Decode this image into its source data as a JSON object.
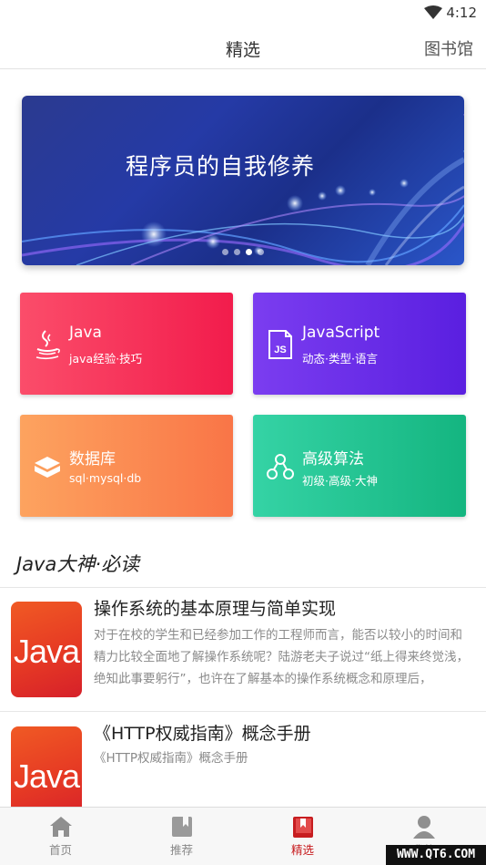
{
  "status_bar": {
    "time": "4:12",
    "wifi_icon": "wifi-icon"
  },
  "header": {
    "title": "精选",
    "library_link": "图书馆"
  },
  "banner": {
    "title": "程序员的自我修养",
    "dot_count": 4,
    "active_dot": 3
  },
  "categories": [
    {
      "name": "Java",
      "sub": "java经验·技巧",
      "icon": "java-cup-icon",
      "colors": [
        "#fb4d6a",
        "#f21c4c"
      ]
    },
    {
      "name": "JavaScript",
      "sub": "动态·类型·语言",
      "icon": "js-icon",
      "colors": [
        "#7b3df0",
        "#5a1fe0"
      ]
    },
    {
      "name": "数据库",
      "sub": "sql·mysql·db",
      "icon": "database-icon",
      "colors": [
        "#fda35f",
        "#f97547"
      ]
    },
    {
      "name": "高级算法",
      "sub": "初级·高级·大神",
      "icon": "algorithm-icon",
      "colors": [
        "#35d3a5",
        "#14b580"
      ]
    }
  ],
  "section": {
    "title": "Java大神·必读"
  },
  "books": [
    {
      "cover_text": "Java",
      "title": "操作系统的基本原理与简单实现",
      "description": "对于在校的学生和已经参加工作的工程师而言，能否以较小的时间和精力比较全面地了解操作系统呢？陆游老夫子说过“纸上得来终觉浅，绝知此事要躬行”，也许在了解基本的操作系统概念和原理后，"
    },
    {
      "cover_text": "Java",
      "title": "《HTTP权威指南》概念手册",
      "description": "《HTTP权威指南》概念手册"
    }
  ],
  "tabs": [
    {
      "label": "首页",
      "icon": "home-icon",
      "active": false
    },
    {
      "label": "推荐",
      "icon": "bookmark-icon",
      "active": false
    },
    {
      "label": "精选",
      "icon": "book-icon",
      "active": true
    },
    {
      "label": "我的",
      "icon": "user-icon",
      "active": false
    }
  ],
  "watermark": "WWW.QT6.COM",
  "accent_color": "#c71d20"
}
